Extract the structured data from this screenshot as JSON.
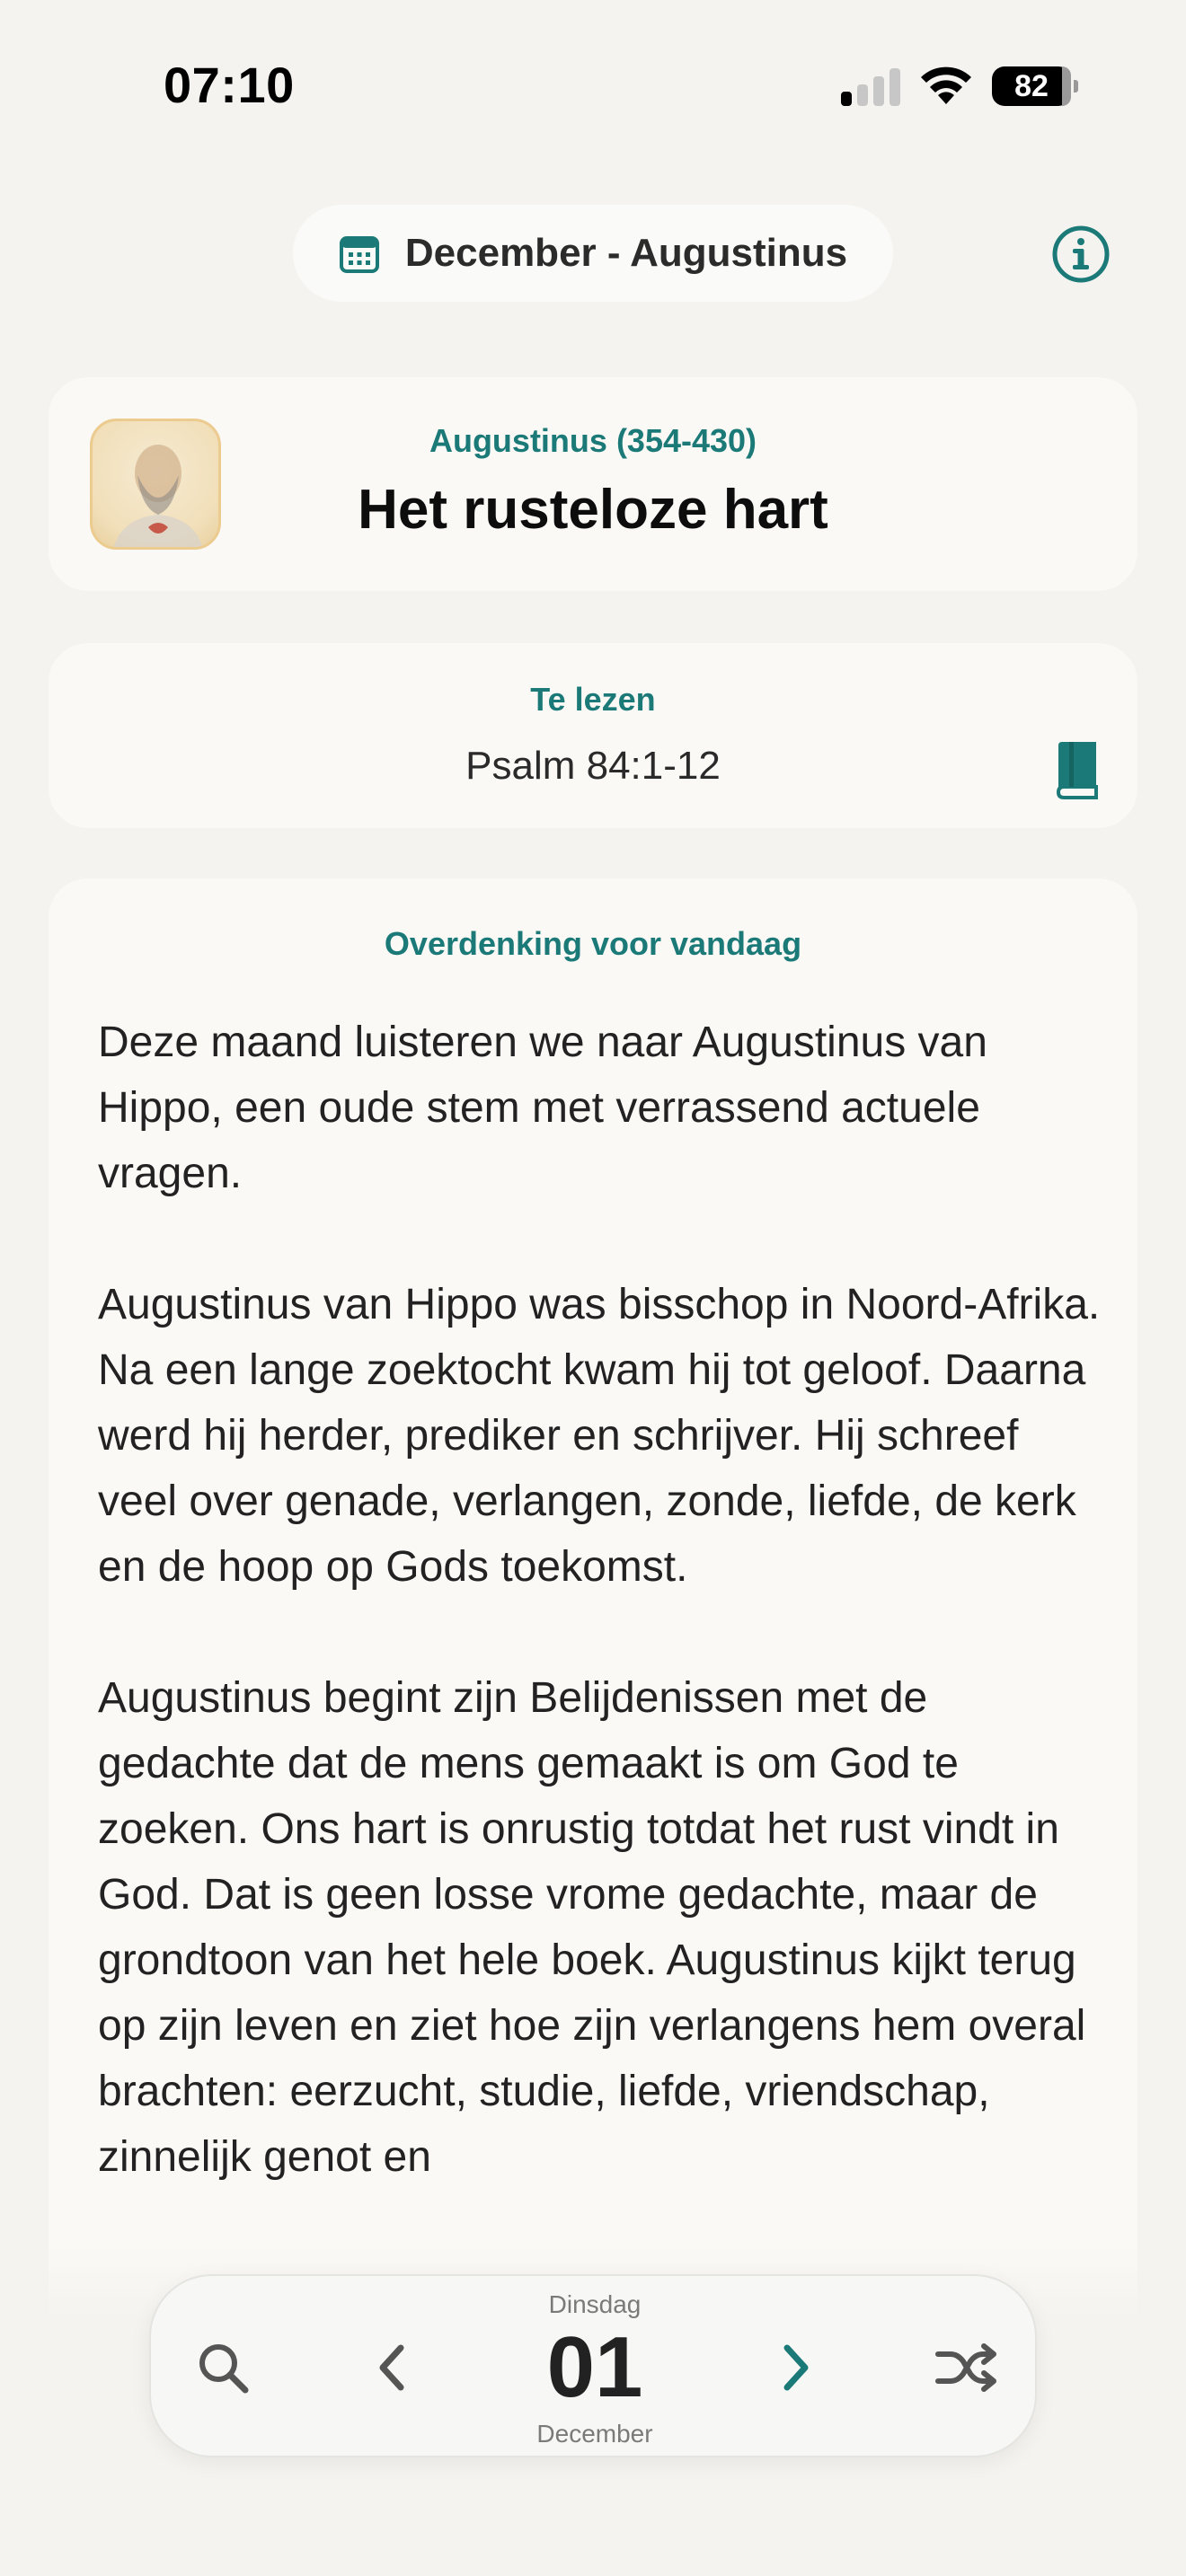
{
  "status_bar": {
    "time": "07:10",
    "battery": "82",
    "icons": [
      "signal-icon",
      "wifi-icon",
      "battery-icon"
    ]
  },
  "header": {
    "month_label": "December - Augustinus",
    "calendar_icon": "calendar-icon",
    "info_icon": "info-icon"
  },
  "title_card": {
    "author": "Augustinus (354-430)",
    "title": "Het rusteloze hart"
  },
  "reading_card": {
    "label": "Te lezen",
    "reference": "Psalm 84:1-12",
    "book_icon": "book-icon"
  },
  "devotion": {
    "label": "Overdenking voor vandaag",
    "paragraphs": [
      "Deze maand luisteren we naar Augustinus van Hippo, een oude stem met verrassend actuele vragen.",
      "Augustinus van Hippo was bisschop in Noord-Afrika. Na een lange zoektocht kwam hij tot geloof. Daarna werd hij herder, prediker en schrijver. Hij schreef veel over genade, verlangen, zonde, liefde, de kerk en de hoop op Gods toekomst.",
      "Augustinus begint zijn Belijdenissen met de gedachte dat de mens gemaakt is om God te zoeken. Ons hart is onrustig totdat het rust vindt in God. Dat is geen losse vrome gedachte, maar de grondtoon van het hele boek. Augustinus kijkt terug op zijn leven en ziet hoe zijn verlangens hem overal brachten: eerzucht, studie, liefde, vriendschap, zinnelijk genot en"
    ]
  },
  "bottom_nav": {
    "weekday": "Dinsdag",
    "day": "01",
    "month": "December",
    "icons": [
      "search-icon",
      "chevron-left-icon",
      "chevron-right-icon",
      "shuffle-icon"
    ]
  },
  "colors": {
    "accent": "#1b7a78",
    "background": "#f4f3ef",
    "card": "#faf9f6"
  }
}
